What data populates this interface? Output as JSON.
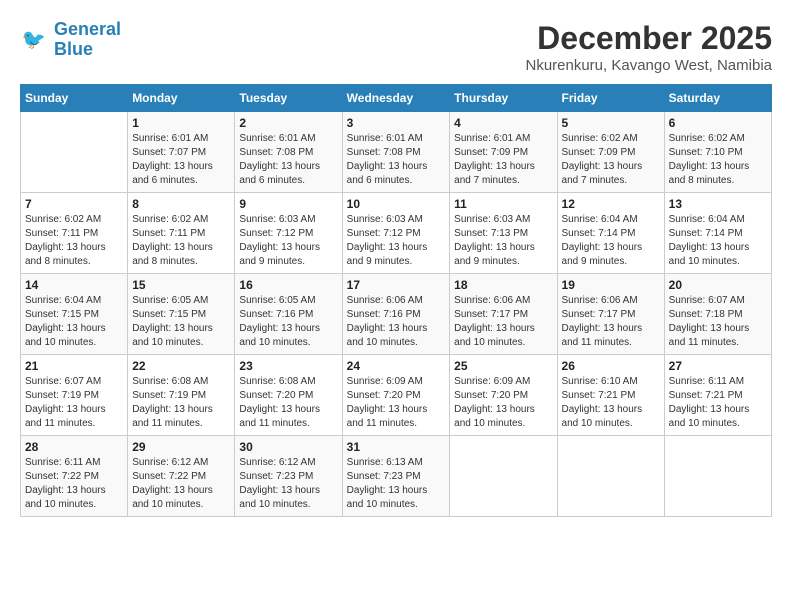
{
  "header": {
    "logo_line1": "General",
    "logo_line2": "Blue",
    "month": "December 2025",
    "location": "Nkurenkuru, Kavango West, Namibia"
  },
  "days_of_week": [
    "Sunday",
    "Monday",
    "Tuesday",
    "Wednesday",
    "Thursday",
    "Friday",
    "Saturday"
  ],
  "weeks": [
    [
      {
        "day": null
      },
      {
        "day": "1",
        "sunrise": "6:01 AM",
        "sunset": "7:07 PM",
        "daylight": "13 hours and 6 minutes."
      },
      {
        "day": "2",
        "sunrise": "6:01 AM",
        "sunset": "7:08 PM",
        "daylight": "13 hours and 6 minutes."
      },
      {
        "day": "3",
        "sunrise": "6:01 AM",
        "sunset": "7:08 PM",
        "daylight": "13 hours and 6 minutes."
      },
      {
        "day": "4",
        "sunrise": "6:01 AM",
        "sunset": "7:09 PM",
        "daylight": "13 hours and 7 minutes."
      },
      {
        "day": "5",
        "sunrise": "6:02 AM",
        "sunset": "7:09 PM",
        "daylight": "13 hours and 7 minutes."
      },
      {
        "day": "6",
        "sunrise": "6:02 AM",
        "sunset": "7:10 PM",
        "daylight": "13 hours and 8 minutes."
      }
    ],
    [
      {
        "day": "7",
        "sunrise": "6:02 AM",
        "sunset": "7:11 PM",
        "daylight": "13 hours and 8 minutes."
      },
      {
        "day": "8",
        "sunrise": "6:02 AM",
        "sunset": "7:11 PM",
        "daylight": "13 hours and 8 minutes."
      },
      {
        "day": "9",
        "sunrise": "6:03 AM",
        "sunset": "7:12 PM",
        "daylight": "13 hours and 9 minutes."
      },
      {
        "day": "10",
        "sunrise": "6:03 AM",
        "sunset": "7:12 PM",
        "daylight": "13 hours and 9 minutes."
      },
      {
        "day": "11",
        "sunrise": "6:03 AM",
        "sunset": "7:13 PM",
        "daylight": "13 hours and 9 minutes."
      },
      {
        "day": "12",
        "sunrise": "6:04 AM",
        "sunset": "7:14 PM",
        "daylight": "13 hours and 9 minutes."
      },
      {
        "day": "13",
        "sunrise": "6:04 AM",
        "sunset": "7:14 PM",
        "daylight": "13 hours and 10 minutes."
      }
    ],
    [
      {
        "day": "14",
        "sunrise": "6:04 AM",
        "sunset": "7:15 PM",
        "daylight": "13 hours and 10 minutes."
      },
      {
        "day": "15",
        "sunrise": "6:05 AM",
        "sunset": "7:15 PM",
        "daylight": "13 hours and 10 minutes."
      },
      {
        "day": "16",
        "sunrise": "6:05 AM",
        "sunset": "7:16 PM",
        "daylight": "13 hours and 10 minutes."
      },
      {
        "day": "17",
        "sunrise": "6:06 AM",
        "sunset": "7:16 PM",
        "daylight": "13 hours and 10 minutes."
      },
      {
        "day": "18",
        "sunrise": "6:06 AM",
        "sunset": "7:17 PM",
        "daylight": "13 hours and 10 minutes."
      },
      {
        "day": "19",
        "sunrise": "6:06 AM",
        "sunset": "7:17 PM",
        "daylight": "13 hours and 11 minutes."
      },
      {
        "day": "20",
        "sunrise": "6:07 AM",
        "sunset": "7:18 PM",
        "daylight": "13 hours and 11 minutes."
      }
    ],
    [
      {
        "day": "21",
        "sunrise": "6:07 AM",
        "sunset": "7:19 PM",
        "daylight": "13 hours and 11 minutes."
      },
      {
        "day": "22",
        "sunrise": "6:08 AM",
        "sunset": "7:19 PM",
        "daylight": "13 hours and 11 minutes."
      },
      {
        "day": "23",
        "sunrise": "6:08 AM",
        "sunset": "7:20 PM",
        "daylight": "13 hours and 11 minutes."
      },
      {
        "day": "24",
        "sunrise": "6:09 AM",
        "sunset": "7:20 PM",
        "daylight": "13 hours and 11 minutes."
      },
      {
        "day": "25",
        "sunrise": "6:09 AM",
        "sunset": "7:20 PM",
        "daylight": "13 hours and 10 minutes."
      },
      {
        "day": "26",
        "sunrise": "6:10 AM",
        "sunset": "7:21 PM",
        "daylight": "13 hours and 10 minutes."
      },
      {
        "day": "27",
        "sunrise": "6:11 AM",
        "sunset": "7:21 PM",
        "daylight": "13 hours and 10 minutes."
      }
    ],
    [
      {
        "day": "28",
        "sunrise": "6:11 AM",
        "sunset": "7:22 PM",
        "daylight": "13 hours and 10 minutes."
      },
      {
        "day": "29",
        "sunrise": "6:12 AM",
        "sunset": "7:22 PM",
        "daylight": "13 hours and 10 minutes."
      },
      {
        "day": "30",
        "sunrise": "6:12 AM",
        "sunset": "7:23 PM",
        "daylight": "13 hours and 10 minutes."
      },
      {
        "day": "31",
        "sunrise": "6:13 AM",
        "sunset": "7:23 PM",
        "daylight": "13 hours and 10 minutes."
      },
      {
        "day": null
      },
      {
        "day": null
      },
      {
        "day": null
      }
    ]
  ],
  "labels": {
    "sunrise_prefix": "Sunrise: ",
    "sunset_prefix": "Sunset: ",
    "daylight_prefix": "Daylight: "
  }
}
